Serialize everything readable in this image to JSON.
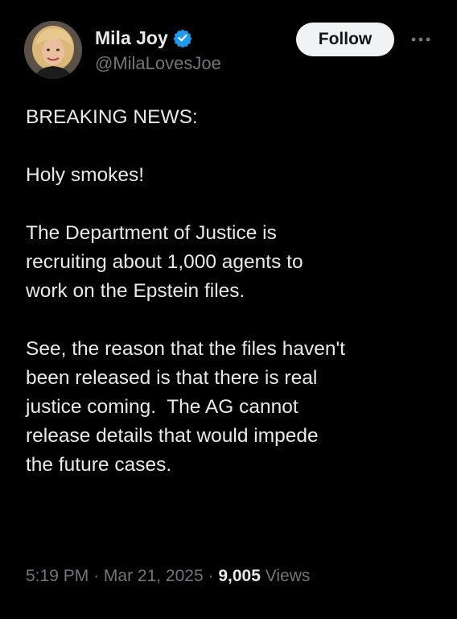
{
  "author": {
    "display_name": "Mila Joy",
    "handle": "@MilaLovesJoe",
    "verified": true,
    "avatar_icon": "avatar-photo"
  },
  "actions": {
    "follow_label": "Follow",
    "more_icon": "more-horizontal-icon"
  },
  "tweet": {
    "paragraphs": [
      [
        "BREAKING NEWS:"
      ],
      [
        "Holy smokes!"
      ],
      [
        "The Department of Justice is",
        "recruiting about 1,000 agents to",
        "work on the Epstein files."
      ],
      [
        "See, the reason that the files haven't",
        "been released is that there is real",
        "justice coming.  The AG cannot",
        "release details that would impede",
        "the future cases."
      ]
    ]
  },
  "meta": {
    "time": "5:19 PM",
    "separator": "·",
    "date": "Mar 21, 2025",
    "views_count": "9,005",
    "views_label": "Views"
  },
  "colors": {
    "background": "#000000",
    "text_primary": "#e7e9ea",
    "text_secondary": "#71767b",
    "verified_blue": "#1d9bf0",
    "follow_bg": "#eff3f4"
  }
}
